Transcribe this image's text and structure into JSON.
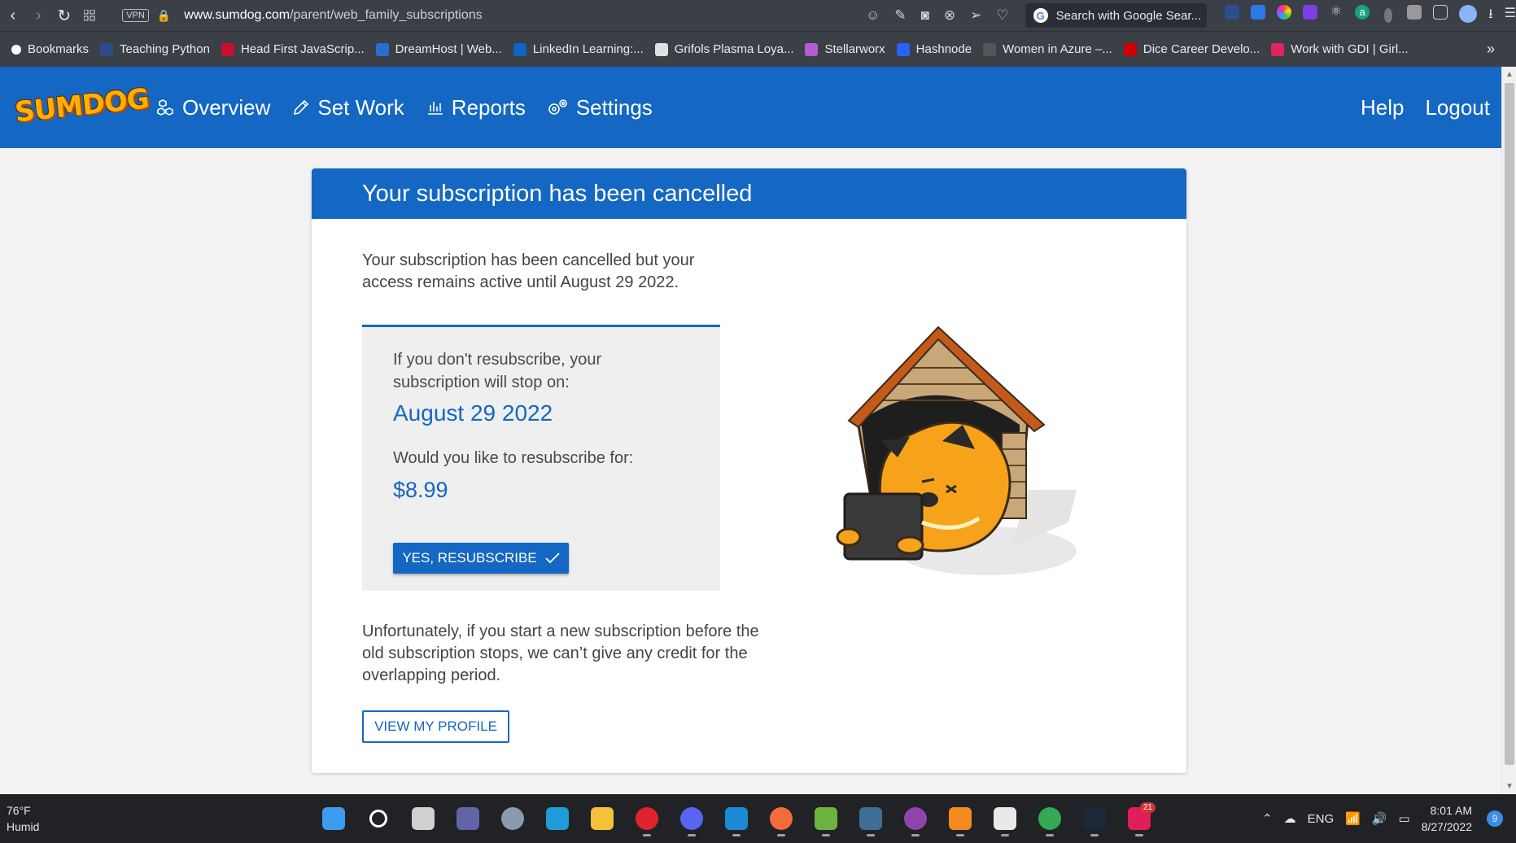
{
  "browser": {
    "url_domain": "www.sumdog.com",
    "url_path": "/parent/web_family_subscriptions",
    "vpn_label": "VPN",
    "search_placeholder": "Search with Google Sear...",
    "bookmarks": [
      {
        "label": "Bookmarks",
        "color": "#ffffff"
      },
      {
        "label": "Teaching Python",
        "color": "#2d4b8a"
      },
      {
        "label": "Head First JavaScrip...",
        "color": "#c8102e"
      },
      {
        "label": "DreamHost | Web...",
        "color": "#2b6cd4"
      },
      {
        "label": "LinkedIn Learning:...",
        "color": "#0a66c2"
      },
      {
        "label": "Grifols Plasma Loya...",
        "color": "#e0e0e0"
      },
      {
        "label": "Stellarworx",
        "color": "#b45cd6"
      },
      {
        "label": "Hashnode",
        "color": "#2962ff"
      },
      {
        "label": "Women in Azure –...",
        "color": "#555555"
      },
      {
        "label": "Dice Career Develo...",
        "color": "#cc0000"
      },
      {
        "label": "Work with GDI | Girl...",
        "color": "#e0245e"
      }
    ]
  },
  "header": {
    "logo_text": "SUMDOG",
    "nav": {
      "overview": "Overview",
      "set_work": "Set Work",
      "reports": "Reports",
      "settings": "Settings"
    },
    "help": "Help",
    "logout": "Logout"
  },
  "card": {
    "title": "Your subscription has been cancelled",
    "intro": "Your subscription has been cancelled but your access remains active until August 29 2022.",
    "box_text": "If you don't resubscribe, your subscription will stop on:",
    "stop_date": "August 29 2022",
    "resub_question": "Would you like to resubscribe for:",
    "price": "$8.99",
    "resub_button": "YES, RESUBSCRIBE",
    "note": "Unfortunately, if you start a new subscription before the old subscription stops, we can’t give any credit for the overlapping period.",
    "profile_button": "VIEW MY PROFILE"
  },
  "taskbar": {
    "temp": "76°F",
    "condition": "Humid",
    "apps": [
      {
        "name": "start",
        "color": "#3c9cf0"
      },
      {
        "name": "search",
        "color": "#202225"
      },
      {
        "name": "task-view",
        "color": "#d0d0d0"
      },
      {
        "name": "teams-chat",
        "color": "#6264a7"
      },
      {
        "name": "settings",
        "color": "#8a9bb0"
      },
      {
        "name": "edge",
        "color": "#1f9bd8"
      },
      {
        "name": "file-explorer",
        "color": "#f3c13a"
      },
      {
        "name": "opera",
        "color": "#e0222c"
      },
      {
        "name": "discord",
        "color": "#5865f2"
      },
      {
        "name": "vscode",
        "color": "#1a8ad4"
      },
      {
        "name": "postman",
        "color": "#f26b3a"
      },
      {
        "name": "spring",
        "color": "#6db33f"
      },
      {
        "name": "mysql-workbench",
        "color": "#3e6e93"
      },
      {
        "name": "github-desktop",
        "color": "#8e44ad"
      },
      {
        "name": "sublime-text",
        "color": "#f58a1f"
      },
      {
        "name": "snipping-tool",
        "color": "#e9e9e9"
      },
      {
        "name": "chrome",
        "color": "#34a853"
      },
      {
        "name": "steam",
        "color": "#1b2838"
      },
      {
        "name": "slack",
        "color": "#e01e5a"
      }
    ],
    "slack_badge": "21",
    "lang": "ENG",
    "time": "8:01 AM",
    "date": "8/27/2022",
    "notifications": "9"
  }
}
